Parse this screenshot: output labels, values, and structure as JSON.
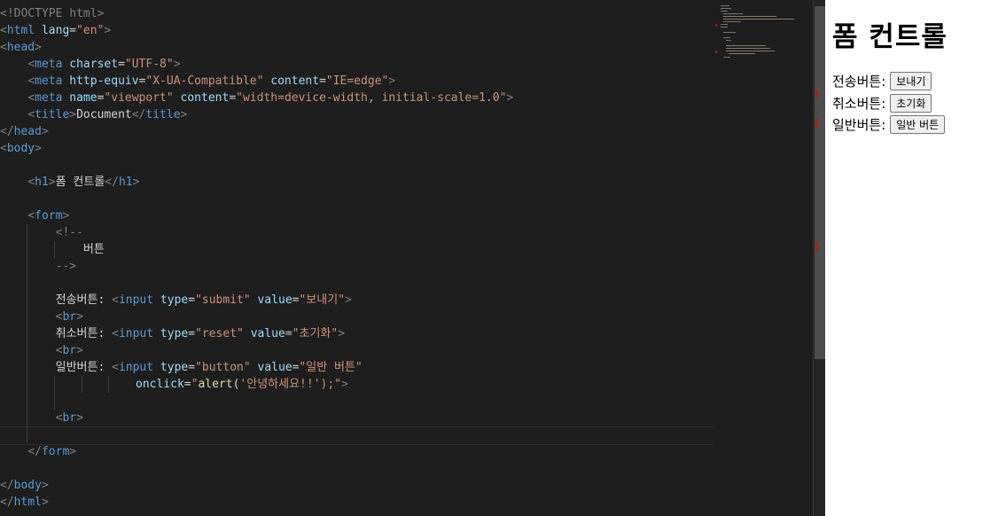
{
  "editor": {
    "lines": {
      "l1": "<!DOCTYPE html>",
      "l2_tag": "html",
      "l2_attr": "lang",
      "l2_val": "\"en\"",
      "l3_tag": "head",
      "l4_tag": "meta",
      "l4_attr": "charset",
      "l4_val": "\"UTF-8\"",
      "l5_tag": "meta",
      "l5_attr1": "http-equiv",
      "l5_val1": "\"X-UA-Compatible\"",
      "l5_attr2": "content",
      "l5_val2": "\"IE=edge\"",
      "l6_tag": "meta",
      "l6_attr1": "name",
      "l6_val1": "\"viewport\"",
      "l6_attr2": "content",
      "l6_val2": "\"width=device-width, initial-scale=1.0\"",
      "l7_tag": "title",
      "l7_text": "Document",
      "l8_tag": "head",
      "l9_tag": "body",
      "l11_tag": "h1",
      "l11_text": "폼 컨트롤",
      "l13_tag": "form",
      "l14": "<!--",
      "l15": "버튼",
      "l16": "-->",
      "l18_label": "전송버튼: ",
      "l18_tag": "input",
      "l18_attr1": "type",
      "l18_val1": "\"submit\"",
      "l18_attr2": "value",
      "l18_val2": "\"보내기\"",
      "l19_tag": "br",
      "l20_label": "취소버튼: ",
      "l20_tag": "input",
      "l20_attr1": "type",
      "l20_val1": "\"reset\"",
      "l20_attr2": "value",
      "l20_val2": "\"초기화\"",
      "l21_tag": "br",
      "l22_label": "일반버튼: ",
      "l22_tag": "input",
      "l22_attr1": "type",
      "l22_val1": "\"button\"",
      "l22_attr2": "value",
      "l22_val2": "\"일반 버튼\"",
      "l23_attr": "onclick",
      "l23_q": "\"",
      "l23_fn": "alert",
      "l23_arg": "'안녕하세요!!'",
      "l23_end": ");\"",
      "l25_tag": "br",
      "l27_tag": "form",
      "l29_tag": "body",
      "l30_tag": "html"
    }
  },
  "preview": {
    "heading": "폼 컨트롤",
    "rows": [
      {
        "label": "전송버튼:",
        "button": "보내기"
      },
      {
        "label": "취소버튼:",
        "button": "초기화"
      },
      {
        "label": "일반버튼:",
        "button": "일반 버튼"
      }
    ]
  },
  "colors": {
    "editor_bg": "#1e1e1e",
    "tag": "#569cd6",
    "attr": "#9cdcfe",
    "string": "#ce9178"
  }
}
